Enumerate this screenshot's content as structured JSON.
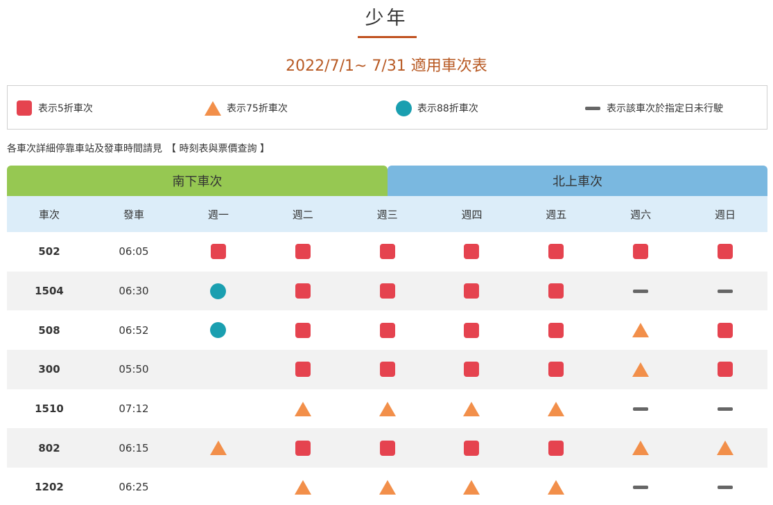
{
  "page": {
    "title": "少年",
    "subtitle": "2022/7/1~ 7/31 適用車次表"
  },
  "colors": {
    "accent": "#c0501e",
    "subtitle": "#b85a24",
    "square": "#e5434f",
    "triangle": "#f28f4a",
    "circle": "#1a9fb0",
    "dash": "#666666",
    "tab_south": "#96c852",
    "tab_north": "#7ab8e0",
    "header_bg": "#dcedf9",
    "row_alt": "#f2f2f2"
  },
  "legend": {
    "square": {
      "icon": "red-square",
      "label": "表示5折車次"
    },
    "triangle": {
      "icon": "orange-triangle",
      "label": "表示75折車次"
    },
    "circle": {
      "icon": "teal-circle",
      "label": "表示88折車次"
    },
    "dash": {
      "icon": "gray-dash",
      "label": "表示該車次於指定日未行駛"
    }
  },
  "note": {
    "text": "各車次詳細停靠車站及發車時間請見",
    "link": "【 時刻表與票價查詢 】"
  },
  "tabs": {
    "south": "南下車次",
    "north": "北上車次"
  },
  "table": {
    "headers": [
      "車次",
      "發車",
      "週一",
      "週二",
      "週三",
      "週四",
      "週五",
      "週六",
      "週日"
    ],
    "rows": [
      {
        "train": "502",
        "time": "06:05",
        "days": [
          "square",
          "square",
          "square",
          "square",
          "square",
          "square",
          "square"
        ]
      },
      {
        "train": "1504",
        "time": "06:30",
        "days": [
          "circle",
          "square",
          "square",
          "square",
          "square",
          "dash",
          "dash"
        ]
      },
      {
        "train": "508",
        "time": "06:52",
        "days": [
          "circle",
          "square",
          "square",
          "square",
          "square",
          "triangle",
          "square"
        ]
      },
      {
        "train": "300",
        "time": "05:50",
        "days": [
          "",
          "square",
          "square",
          "square",
          "square",
          "triangle",
          "square"
        ]
      },
      {
        "train": "1510",
        "time": "07:12",
        "days": [
          "",
          "triangle",
          "triangle",
          "triangle",
          "triangle",
          "dash",
          "dash"
        ]
      },
      {
        "train": "802",
        "time": "06:15",
        "days": [
          "triangle",
          "square",
          "square",
          "square",
          "square",
          "triangle",
          "triangle"
        ]
      },
      {
        "train": "1202",
        "time": "06:25",
        "days": [
          "",
          "triangle",
          "triangle",
          "triangle",
          "triangle",
          "dash",
          "dash"
        ]
      }
    ]
  }
}
